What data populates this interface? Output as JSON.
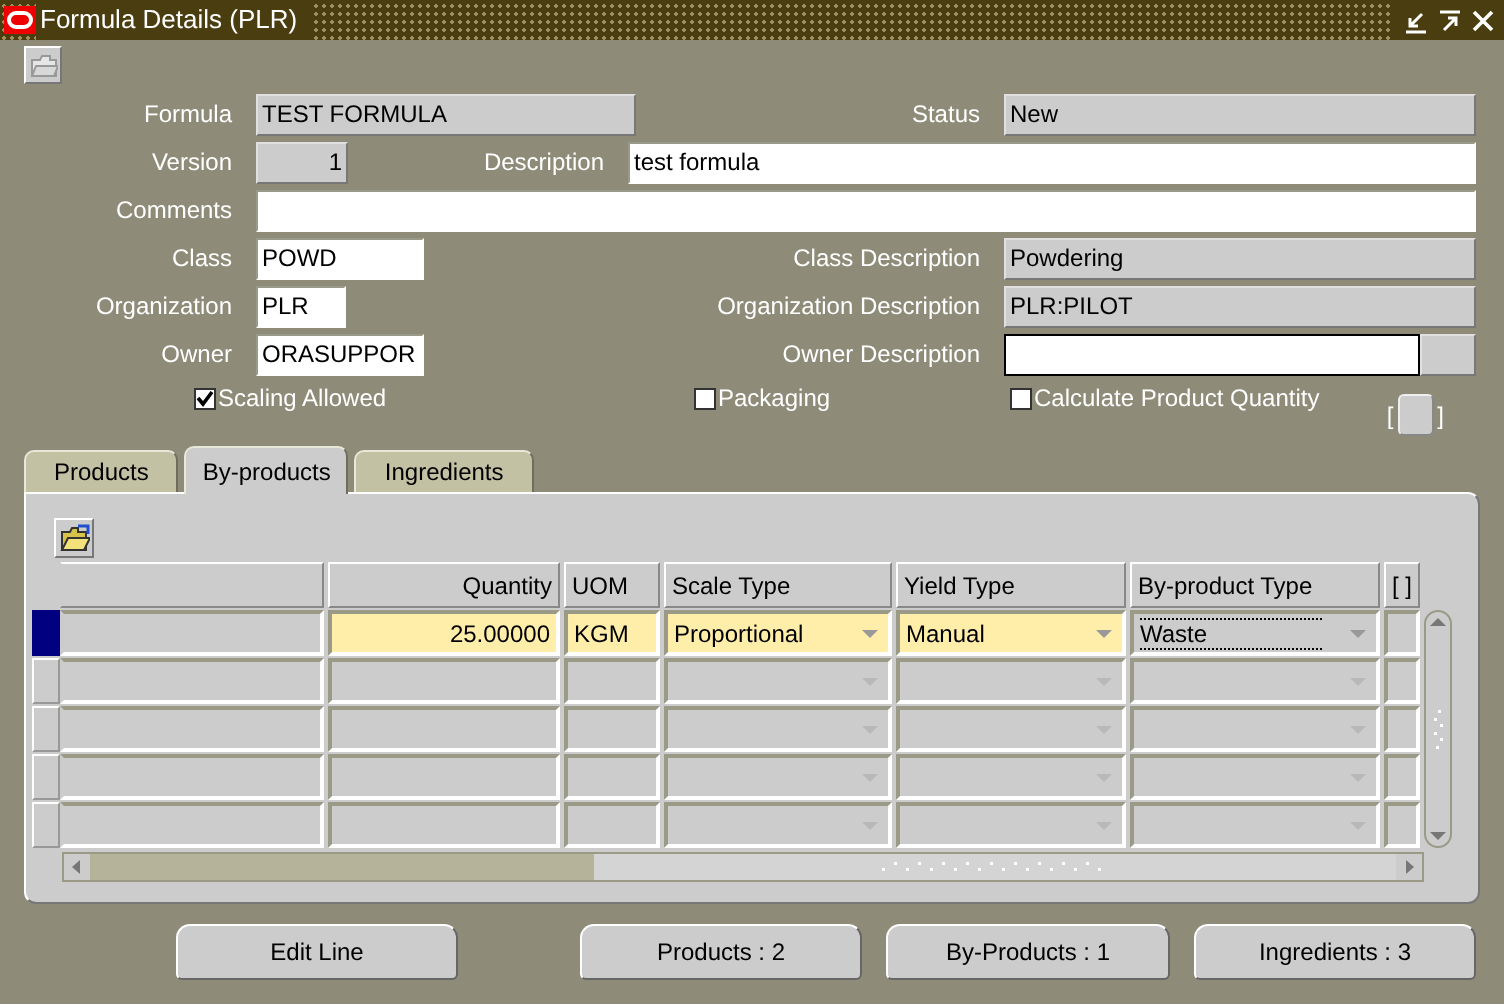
{
  "window": {
    "title": "Formula Details (PLR)"
  },
  "header": {
    "rows": [
      [
        {
          "label": "Formula"
        },
        {
          "value": "TEST FORMULA",
          "kind": "readonly"
        },
        {
          "label": "Status"
        },
        {
          "value": "New",
          "kind": "readonly"
        }
      ],
      [
        {
          "label": "Version"
        },
        {
          "value": "1",
          "kind": "number"
        },
        {
          "label": "Description"
        },
        {
          "value": "test formula",
          "kind": "editable"
        }
      ],
      [
        {
          "label": "Comments"
        },
        {
          "kind": "editable"
        }
      ],
      [
        {
          "label": "Class"
        },
        {
          "value": "POWD",
          "kind": "editable"
        },
        {
          "label": "Class Description"
        },
        {
          "value": "Powdering",
          "kind": "readonly"
        }
      ],
      [
        {
          "label": "Organization"
        },
        {
          "value": "PLR",
          "kind": "editable"
        },
        {
          "label": "Organization Description"
        },
        {
          "value": "PLR:PILOT",
          "kind": "readonly"
        }
      ],
      [
        {
          "label": "Owner"
        },
        {
          "value": "ORASUPPOR",
          "kind": "editable"
        },
        {
          "label": "Owner Description"
        },
        {
          "kind": "lov"
        }
      ]
    ],
    "checkboxes": [
      {
        "label": "Scaling Allowed",
        "checked": true
      },
      {
        "label": "Packaging",
        "checked": false
      },
      {
        "label": "Calculate Product Quantity",
        "checked": false
      }
    ],
    "bracket_left": "[",
    "bracket_right": "]"
  },
  "tabs": [
    {
      "label": "Products",
      "selected": false
    },
    {
      "label": "By-products",
      "selected": true
    },
    {
      "label": "Ingredients",
      "selected": false
    }
  ],
  "table": {
    "columns": [
      {
        "kind": "text"
      },
      {
        "label": "Quantity",
        "kind": "number"
      },
      {
        "label": "UOM",
        "kind": "text"
      },
      {
        "label": "Scale Type",
        "kind": "dropdown"
      },
      {
        "label": "Yield Type",
        "kind": "dropdown"
      },
      {
        "label": "By-product Type",
        "kind": "dropdown"
      },
      {
        "label": "[ ]",
        "kind": "flag"
      }
    ],
    "rows": [
      {
        "selected": true,
        "cells": [
          {},
          {
            "value": "25.00000",
            "required": true
          },
          {
            "value": "KGM",
            "required": true
          },
          {
            "value": "Proportional",
            "required": true
          },
          {
            "value": "Manual",
            "required": true
          },
          {
            "value": "Waste",
            "required": false,
            "focused": true
          },
          {}
        ]
      }
    ]
  },
  "buttons": [
    "Edit Line",
    "Products : 2",
    "By-Products : 1",
    "Ingredients : 3"
  ]
}
